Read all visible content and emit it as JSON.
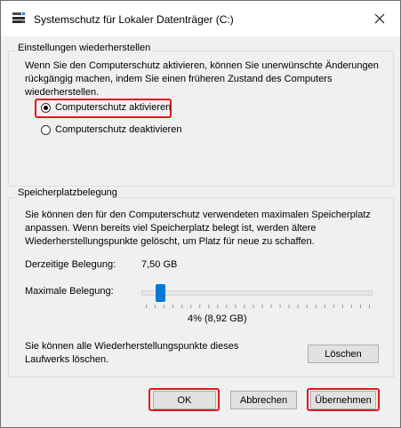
{
  "window": {
    "title": "Systemschutz für Lokaler Datenträger (C:)"
  },
  "restore_settings": {
    "group_title": "Einstellungen wiederherstellen",
    "description_lines": [
      "Wenn Sie den Computerschutz aktivieren, können Sie unerwünschte Änderungen",
      "rückgängig machen, indem Sie einen früheren Zustand des Computers",
      "wiederherstellen."
    ],
    "options": [
      {
        "label": "Computerschutz aktivieren",
        "selected": true
      },
      {
        "label": "Computerschutz deaktivieren",
        "selected": false
      }
    ]
  },
  "disk_space": {
    "group_title": "Speicherplatzbelegung",
    "description_lines": [
      "Sie können den für den Computerschutz verwendeten maximalen Speicherplatz",
      "anpassen. Wenn bereits viel Speicherplatz belegt ist, werden ältere",
      "Wiederherstellungspunkte gelöscht, um Platz für neue zu schaffen."
    ],
    "current_usage_label": "Derzeitige Belegung:",
    "current_usage_value": "7,50 GB",
    "max_usage_label": "Maximale Belegung:",
    "max_usage_percent": 4,
    "max_usage_display": "4% (8,92 GB)",
    "delete_text_lines": [
      "Sie können alle Wiederherstellungspunkte dieses",
      "Laufwerks löschen."
    ],
    "delete_button": "Löschen"
  },
  "footer": {
    "ok": "OK",
    "cancel": "Abbrechen",
    "apply": "Übernehmen"
  },
  "colors": {
    "highlight": "#e0161e",
    "accent": "#0078d7"
  }
}
